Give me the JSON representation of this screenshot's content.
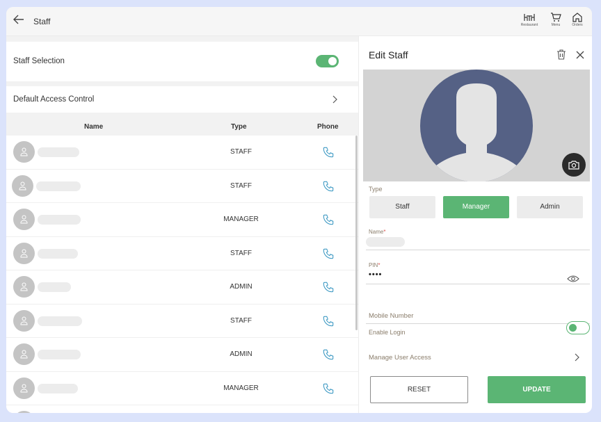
{
  "header": {
    "title": "Staff",
    "back_icon": "arrow-left-icon",
    "nav": [
      {
        "label": "Restaurant",
        "icon": "dining-table-icon"
      },
      {
        "label": "Menu",
        "icon": "cart-icon"
      },
      {
        "label": "Orders",
        "icon": "home-icon"
      }
    ]
  },
  "settings": {
    "staff_selection_label": "Staff Selection",
    "staff_selection_on": true,
    "default_access_label": "Default Access Control"
  },
  "table": {
    "columns": [
      "Name",
      "Type",
      "Phone"
    ],
    "rows": [
      {
        "type": "STAFF"
      },
      {
        "type": "STAFF"
      },
      {
        "type": "MANAGER"
      },
      {
        "type": "STAFF"
      },
      {
        "type": "ADMIN"
      },
      {
        "type": "STAFF"
      },
      {
        "type": "ADMIN"
      },
      {
        "type": "MANAGER"
      }
    ]
  },
  "edit_panel": {
    "title": "Edit Staff",
    "type_label": "Type",
    "type_options": [
      "Staff",
      "Manager",
      "Admin"
    ],
    "selected_type": "Manager",
    "name_label": "Name",
    "pin_label": "PIN",
    "required_mark": "*",
    "pin_value": "••••",
    "mobile_label": "Mobile Number",
    "enable_login_label": "Enable Login",
    "enable_login_on": true,
    "manage_access_label": "Manage User Access",
    "reset_label": "RESET",
    "update_label": "UPDATE"
  },
  "colors": {
    "accent": "#5bb574",
    "avatar_bg": "#556185",
    "background": "#dbe3fb"
  }
}
